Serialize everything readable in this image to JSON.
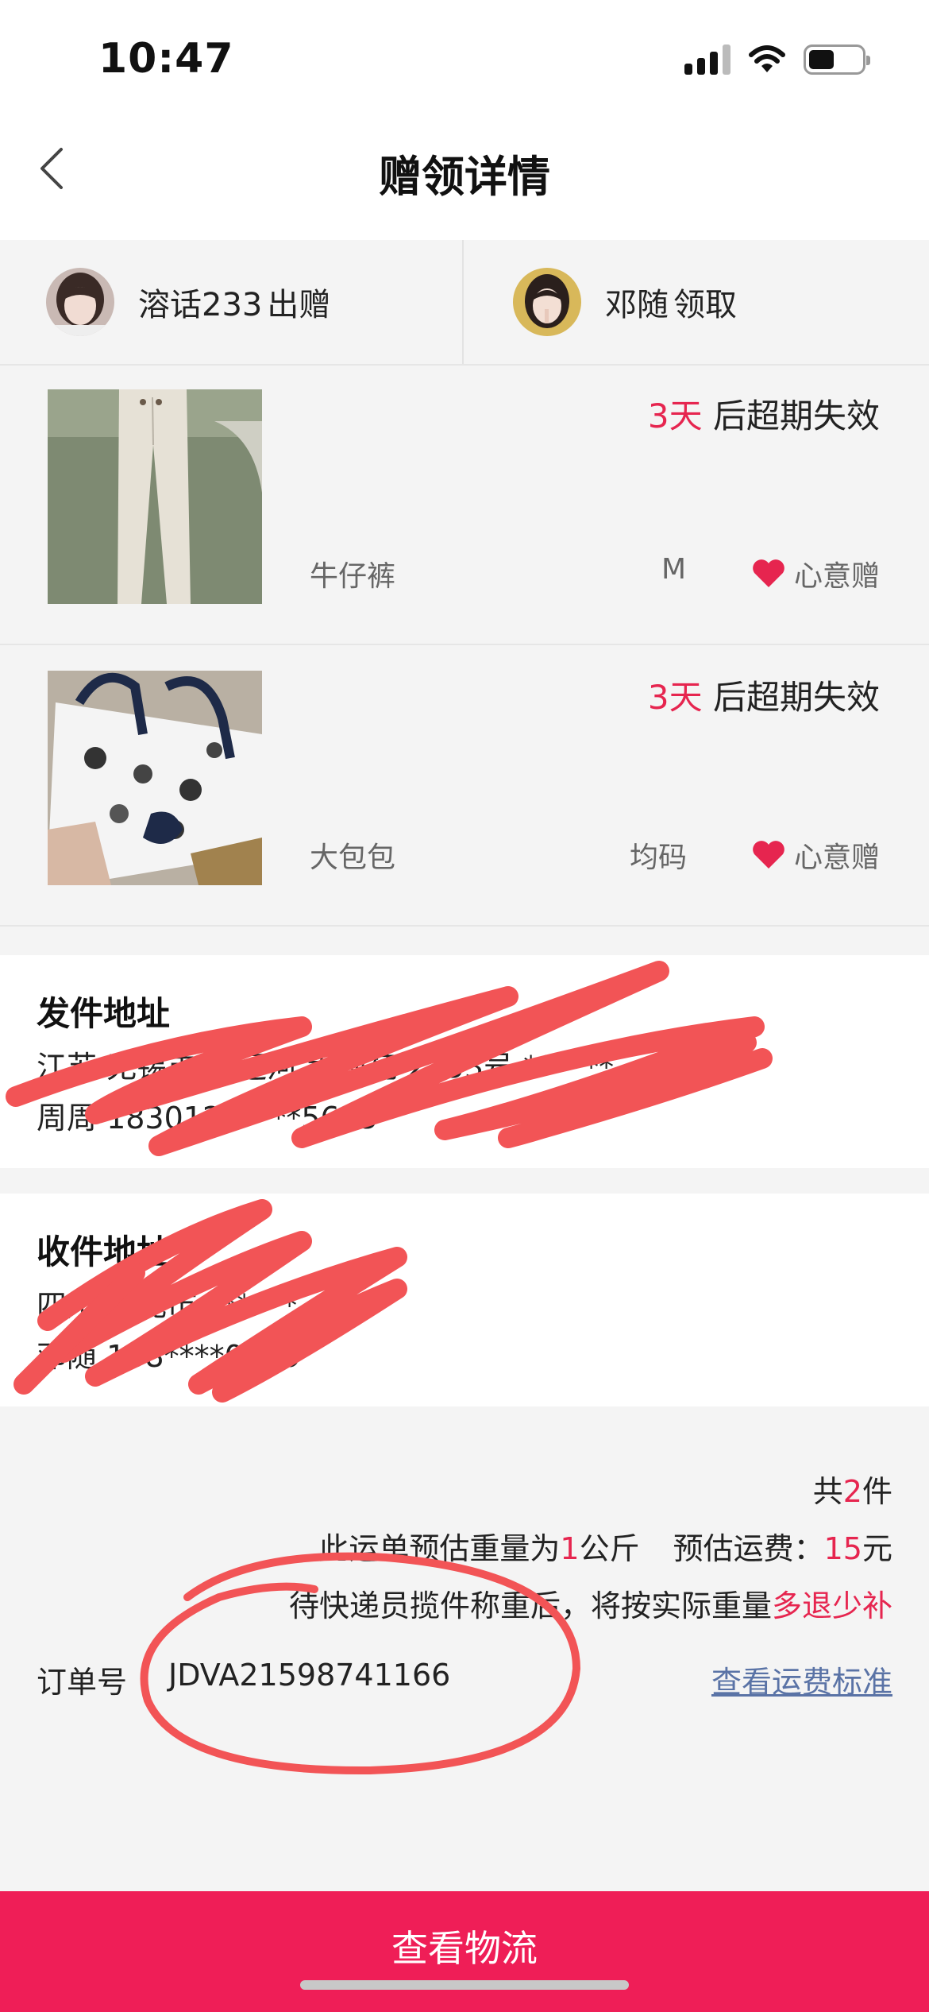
{
  "status_bar": {
    "time": "10:47",
    "icons": [
      "cellular-signal-icon",
      "wifi-icon",
      "battery-icon"
    ]
  },
  "nav": {
    "title": "赠领详情",
    "back_icon": "chevron-left-icon"
  },
  "giver": {
    "name": "溶话233",
    "action": "出赠"
  },
  "receiver": {
    "name": "邓随",
    "action": "领取"
  },
  "items": [
    {
      "days": "3天",
      "expire_text": "后超期失效",
      "name": "牛仔裤",
      "size": "M",
      "tag": "心意赠"
    },
    {
      "days": "3天",
      "expire_text": "后超期失效",
      "name": "大包包",
      "size": "均码",
      "tag": "心意赠"
    }
  ],
  "sender_address": {
    "title": "发件地址",
    "line1": "江苏 无锡市 古运河 大观苑 2353号 ******",
    "line2": "周周 1830120****5635"
  },
  "receiver_address": {
    "title": "收件地址",
    "line1": "四川 南充市 ******",
    "line2": "邓随 188****0419"
  },
  "summary": {
    "count_prefix": "共",
    "count": "2",
    "count_suffix": "件",
    "weight_prefix": "此运单预估重量为",
    "weight": "1",
    "weight_unit": "公斤",
    "fee_label": "预估运费：",
    "fee": "15",
    "fee_unit": "元",
    "note_prefix": "待快递员揽件称重后，将按实际重量",
    "note_highlight": "多退少补",
    "order_label": "订单号",
    "order_number": "JDVA21598741166",
    "freight_link": "查看运费标准"
  },
  "bottom_button": "查看物流",
  "colors": {
    "accent": "#ef1e57",
    "highlight": "#e6254f",
    "link": "#5a73a6",
    "scribble": "#f25456"
  }
}
